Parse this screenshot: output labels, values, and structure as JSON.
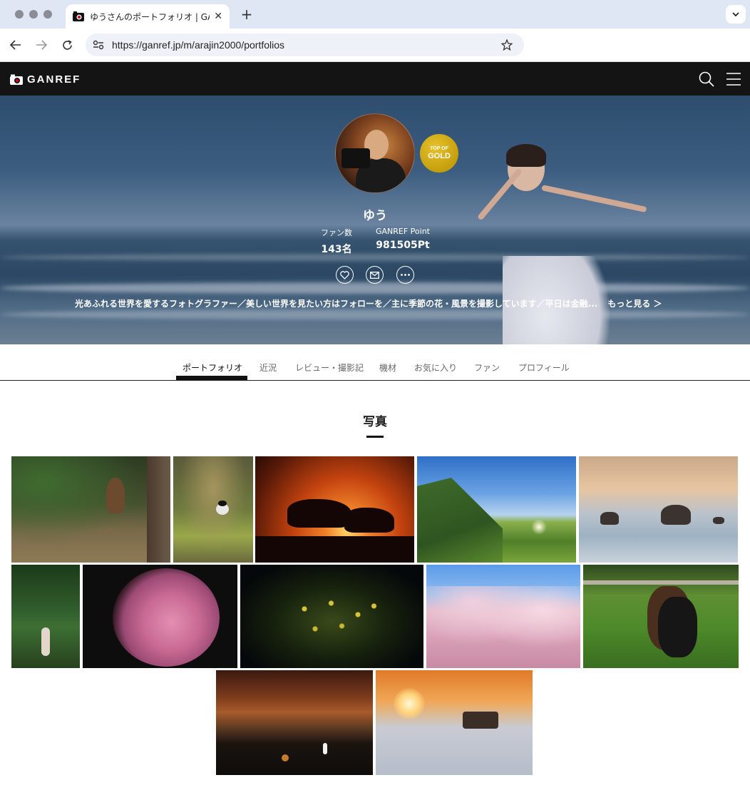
{
  "browser": {
    "tab_title": "ゆうさんのポートフォリオ | GANREF",
    "url": "https://ganref.jp/m/arajin2000/portfolios"
  },
  "site": {
    "logo_text": "GANREF"
  },
  "profile": {
    "name": "ゆう",
    "badge_top": "TOP OF",
    "badge_bottom": "GOLD",
    "fans_label": "ファン数",
    "fans_value": "143名",
    "points_label": "GANREF Point",
    "points_value": "981505Pt",
    "bio": "光あふれる世界を愛するフォトグラファー／美しい世界を見たい方はフォローを／主に季節の花・風景を撮影しています／平日は金融...",
    "more_label": "もっと見る ＞"
  },
  "subnav": {
    "items": [
      "ポートフォリオ",
      "近況",
      "レビュー・撮影記",
      "機材",
      "お気に入り",
      "ファン",
      "プロフィール"
    ],
    "active": "ポートフォリオ"
  },
  "section": {
    "title": "写真"
  },
  "photos": [
    {
      "subject": "squirrel"
    },
    {
      "subject": "wagtail"
    },
    {
      "subject": "horses-sunset"
    },
    {
      "subject": "mountain-sunrise"
    },
    {
      "subject": "meoto-iwa"
    },
    {
      "subject": "forest-portrait"
    },
    {
      "subject": "pink-rose"
    },
    {
      "subject": "rapeseed-night"
    },
    {
      "subject": "cherry-blossoms"
    },
    {
      "subject": "horses-pasture"
    },
    {
      "subject": "autumn-pond-egret"
    },
    {
      "subject": "frost-car-sunrise"
    }
  ],
  "colors": {
    "header_bg": "#141414",
    "badge_gold": "#c49f0c"
  }
}
